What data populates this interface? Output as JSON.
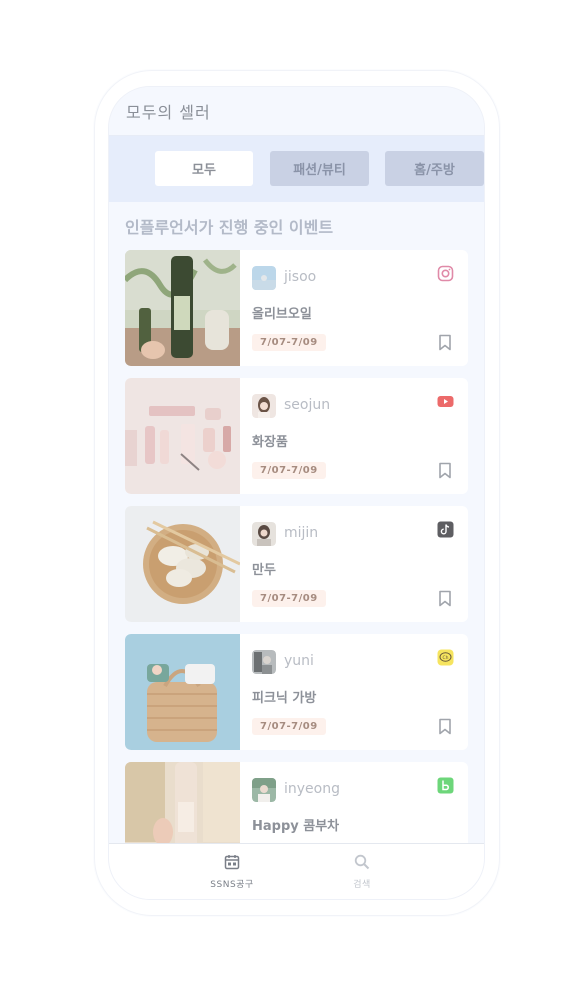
{
  "app": {
    "title": "모두의 셀러"
  },
  "tabs": [
    {
      "label": "모두",
      "active": true
    },
    {
      "label": "패션/뷰티",
      "active": false
    },
    {
      "label": "홈/주방",
      "active": false
    }
  ],
  "section": {
    "title": "인플루언서가 진행 중인 이벤트"
  },
  "events": [
    {
      "username": "jisoo",
      "product": "올리브오일",
      "date": "7/07-7/09",
      "platform": "instagram-icon"
    },
    {
      "username": "seojun",
      "product": "화장품",
      "date": "7/07-7/09",
      "platform": "youtube-icon"
    },
    {
      "username": "mijin",
      "product": "만두",
      "date": "7/07-7/09",
      "platform": "tiktok-icon"
    },
    {
      "username": "yuni",
      "product": "피크닉 가방",
      "date": "7/07-7/09",
      "platform": "kakao-icon"
    },
    {
      "username": "inyeong",
      "product": "Happy 콤부차",
      "date": "",
      "platform": "band-icon"
    }
  ],
  "bottom_nav": [
    {
      "label": "SSNS공구",
      "icon": "calendar-icon",
      "active": true
    },
    {
      "label": "검색",
      "icon": "search-icon",
      "active": false
    }
  ],
  "colors": {
    "background": "#f5f8fe",
    "tabbar": "#e6edfb",
    "tab_inactive": "#c9d1e4",
    "date_badge": "#fdf1ec"
  }
}
